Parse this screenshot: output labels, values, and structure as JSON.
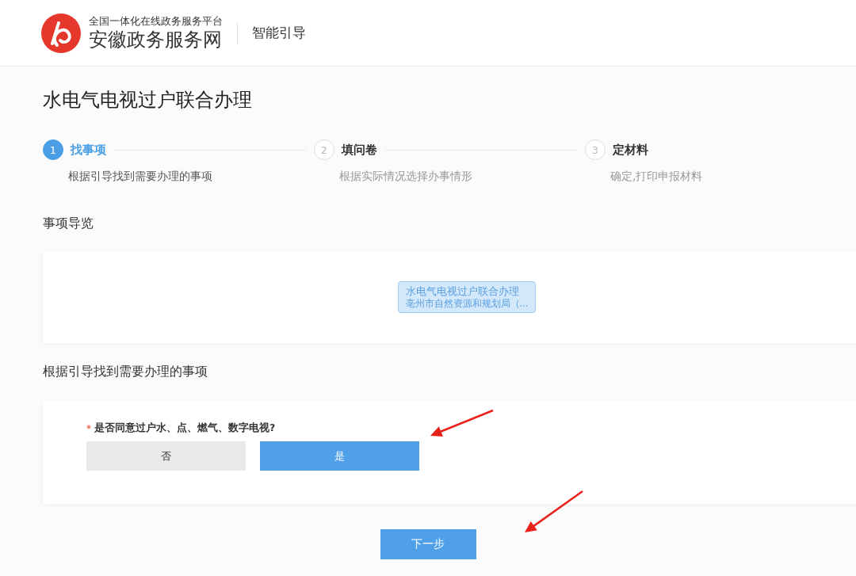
{
  "header": {
    "platform_subtitle": "全国一体化在线政务服务平台",
    "platform_name": "安徽政务服务网",
    "section": "智能引导"
  },
  "page_title": "水电气电视过户联合办理",
  "steps": [
    {
      "number": "1",
      "title": "找事项",
      "description": "根据引导找到需要办理的事项",
      "selected": true
    },
    {
      "number": "2",
      "title": "填问卷",
      "description": "根据实际情况选择办事情形",
      "selected": false
    },
    {
      "number": "3",
      "title": "定材料",
      "description": "确定,打印申报材料",
      "selected": false
    }
  ],
  "overview": {
    "label": "事项导览",
    "node": {
      "title": "水电气电视过户联合办理",
      "subtitle": "亳州市自然资源和规划局（..."
    }
  },
  "questionnaire": {
    "label": "根据引导找到需要办理的事项",
    "question": {
      "required_mark": "*",
      "text": "是否同意过户水、点、燃气、数字电视?",
      "options": [
        {
          "label": "否",
          "selected": false
        },
        {
          "label": "是",
          "selected": true
        }
      ]
    }
  },
  "next_button": "下一步"
}
